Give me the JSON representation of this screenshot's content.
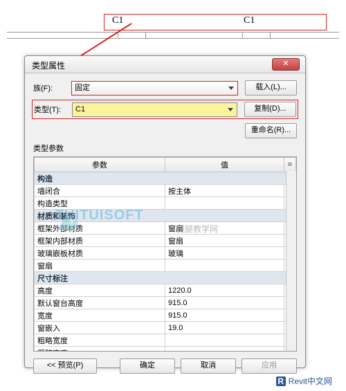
{
  "top": {
    "tag1": "C1",
    "tag2": "C1"
  },
  "dialog": {
    "title": "类型属性",
    "family_label": "族(F):",
    "family_value": "固定",
    "type_label": "类型(T):",
    "type_value": "C1",
    "btn_load": "载入(L)...",
    "btn_duplicate": "复制(D)...",
    "btn_rename": "重命名(R)...",
    "params_heading": "类型参数",
    "col_param": "参数",
    "col_value": "值",
    "rows": [
      {
        "group": true,
        "label": "构造"
      },
      {
        "label": "墙闭合",
        "value": "按主体"
      },
      {
        "label": "构造类型",
        "value": ""
      },
      {
        "group": true,
        "label": "材质和装饰"
      },
      {
        "label": "框架外部材质",
        "value": "窗扇"
      },
      {
        "label": "框架内部材质",
        "value": "窗扇"
      },
      {
        "label": "玻璃嵌板材质",
        "value": "玻璃"
      },
      {
        "label": "窗扇",
        "value": ""
      },
      {
        "group": true,
        "label": "尺寸标注"
      },
      {
        "label": "高度",
        "value": "1220.0"
      },
      {
        "label": "默认窗台高度",
        "value": "915.0"
      },
      {
        "label": "宽度",
        "value": "915.0"
      },
      {
        "label": "窗嵌入",
        "value": "19.0"
      },
      {
        "label": "粗略宽度",
        "value": ""
      },
      {
        "label": "粗略高度",
        "value": ""
      }
    ],
    "btn_preview": "<< 预览(P)",
    "btn_ok": "确定",
    "btn_cancel": "取消",
    "btn_apply": "应用"
  },
  "watermark": {
    "main": "TUITUISOFT",
    "sub": "腿腿教学网"
  },
  "footer": {
    "text": "Revit中文网"
  }
}
